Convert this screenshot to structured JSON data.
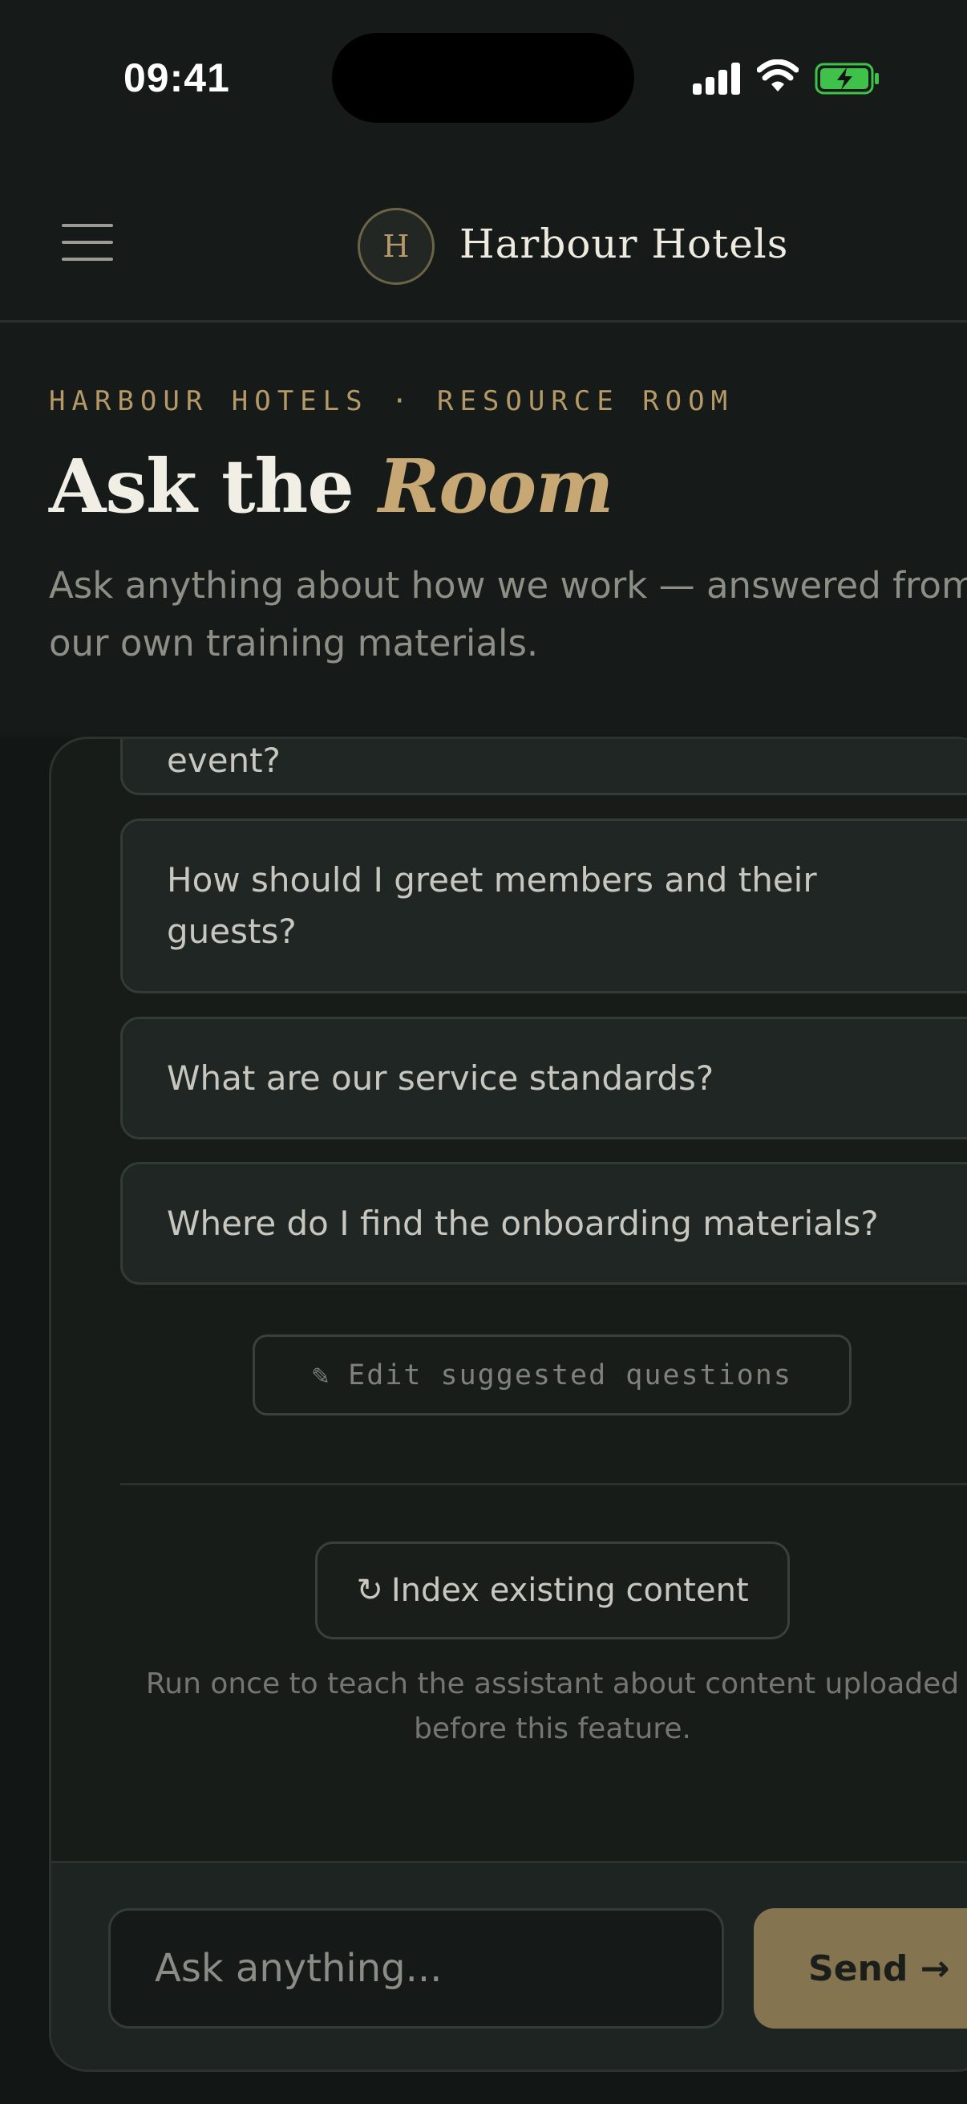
{
  "status_bar": {
    "time": "09:41",
    "icons": [
      "signal-icon",
      "wifi-icon",
      "battery-charging-icon"
    ],
    "battery_color": "#3fc24a"
  },
  "header": {
    "logo_letter": "H",
    "brand_name": "Harbour Hotels",
    "menu_icon": "hamburger-menu-icon"
  },
  "hero": {
    "eyebrow": "HARBOUR HOTELS · RESOURCE ROOM",
    "title_plain": "Ask the ",
    "title_accent": "Room",
    "subtitle_line1": "Ask anything about how we work — answered from",
    "subtitle_line2": "our own training materials."
  },
  "suggested_questions": [
    "What's the setup process for a private event?",
    "How should I greet members and their guests?",
    "What are our service standards?",
    "Where do I find the onboarding materials?"
  ],
  "edit_button": {
    "icon": "pencil-icon",
    "glyph": "✎",
    "label": "Edit suggested questions"
  },
  "index_button": {
    "icon": "refresh-icon",
    "glyph": "↻",
    "label": "Index existing content"
  },
  "index_help": "Run once to teach the assistant about content uploaded before this feature.",
  "composer": {
    "placeholder": "Ask anything...",
    "send_label": "Send →"
  },
  "colors": {
    "accent_gold": "#c7a874",
    "background": "#121614",
    "send_button": "#857450"
  }
}
